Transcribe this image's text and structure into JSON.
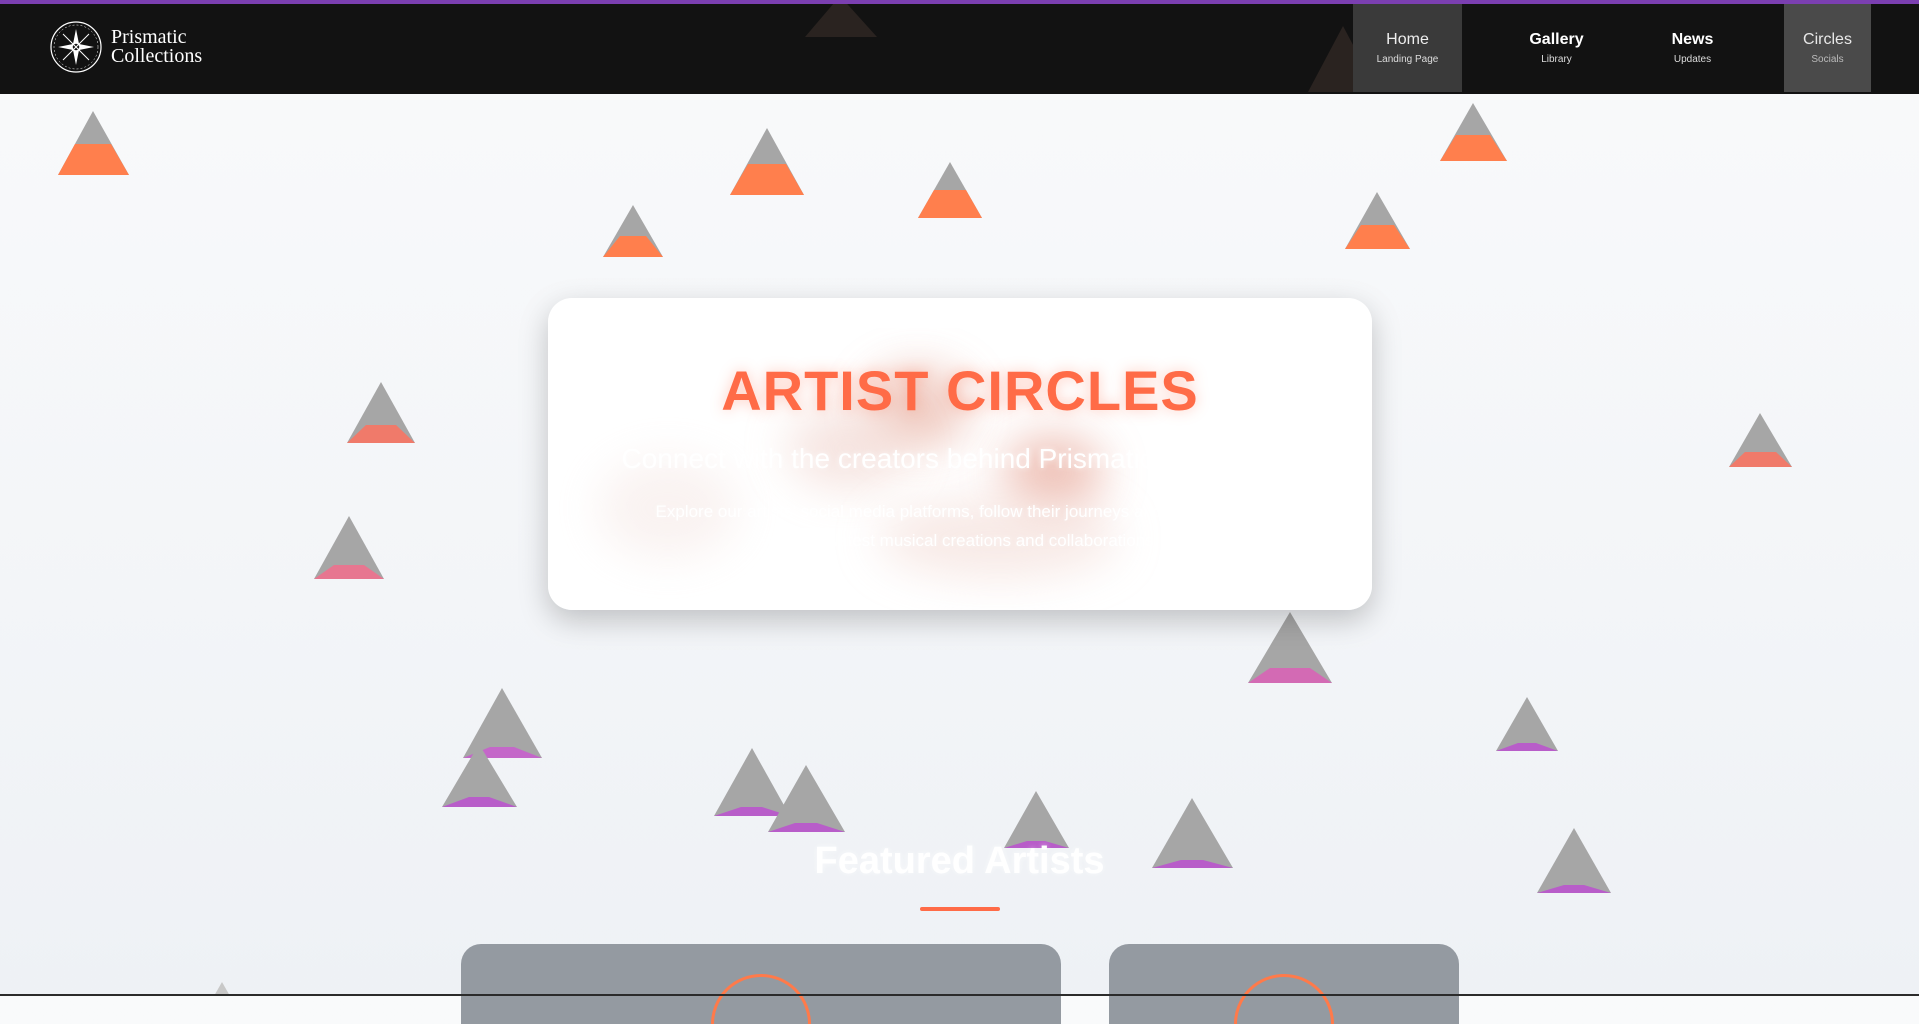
{
  "brand": {
    "name_line1": "Prismatic",
    "name_line2": "Collections",
    "accent_color": "#ff6b47",
    "top_bar_color": "#7b3fb1",
    "nav_bg": "#121212",
    "logo_icon": "compass-star-icon"
  },
  "nav": {
    "items": [
      {
        "title": "Home",
        "subtitle": "Landing Page"
      },
      {
        "title": "Gallery",
        "subtitle": "Library"
      },
      {
        "title": "News",
        "subtitle": "Updates"
      },
      {
        "title": "Circles",
        "subtitle": "Socials"
      }
    ],
    "active": "Circles"
  },
  "hero": {
    "title": "ARTIST CIRCLES",
    "subtitle": "Connect with the creators behind Prismatic Collections",
    "description": "Explore our artists' social media platforms, follow their journeys and stay updated with their latest musical creations and collaborations."
  },
  "featured": {
    "title": "Featured Artists"
  }
}
